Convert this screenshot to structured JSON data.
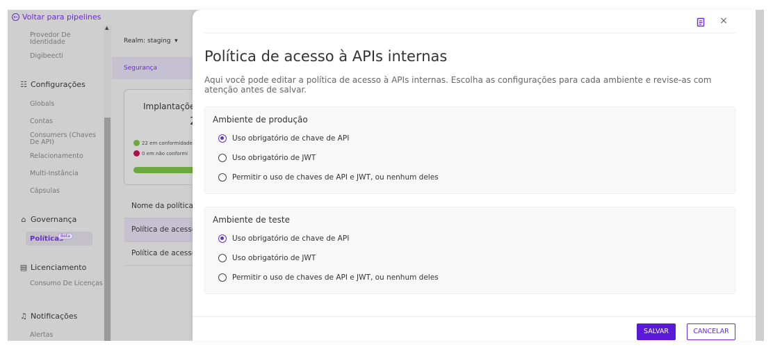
{
  "colors": {
    "accent": "#6a2bd6",
    "primary_button": "#5a19d6",
    "compliant": "#6ca83f",
    "non_compliant": "#b0104a"
  },
  "sidebar": {
    "back_link": "Voltar para pipelines",
    "top_items": [
      "Provedor De Identidade",
      "Digibeecti"
    ],
    "config_group": {
      "label": "Configurações",
      "icon": "settings-panel-icon"
    },
    "config_items": [
      "Globals",
      "Contas",
      "Consumers (Chaves De API)",
      "Relacionamento",
      "Multi-Instância",
      "Cápsulas"
    ],
    "governance_group": {
      "label": "Governança",
      "icon": "bank-icon"
    },
    "active_item": "Políticas",
    "beta_badge": "Beta",
    "licensing_group": {
      "label": "Licenciamento",
      "icon": "license-icon"
    },
    "licensing_items": [
      "Consumo De Licenças"
    ],
    "notifications_group": {
      "label": "Notificações",
      "icon": "bell-icon"
    },
    "notifications_items": [
      "Alertas"
    ]
  },
  "background": {
    "realm_label": "Realm: staging",
    "tab_label": "Segurança",
    "card_title": "Implantaçõe",
    "card_count": "2",
    "legend_compliant": "22 em conformidade",
    "legend_non_compliant": "0 em não conformi",
    "table_header": "Nome da política",
    "table_rows": [
      "Política de acesso",
      "Política de acesso"
    ]
  },
  "drawer": {
    "title": "Política de acesso à APIs internas",
    "description": "Aqui você pode editar a política de acesso à APIs internas. Escolha as configurações para cada ambiente e revise-as com atenção antes de salvar.",
    "sections": [
      {
        "title": "Ambiente de produção",
        "options": [
          "Uso obrigatório de chave de API",
          "Uso obrigatório de JWT",
          "Permitir o uso de chaves de API e JWT, ou nenhum deles"
        ],
        "selected": 0
      },
      {
        "title": "Ambiente de teste",
        "options": [
          "Uso obrigatório de chave de API",
          "Uso obrigatório de JWT",
          "Permitir o uso de chaves de API e JWT, ou nenhum deles"
        ],
        "selected": 0
      }
    ],
    "save_label": "SALVAR",
    "cancel_label": "CANCELAR"
  }
}
